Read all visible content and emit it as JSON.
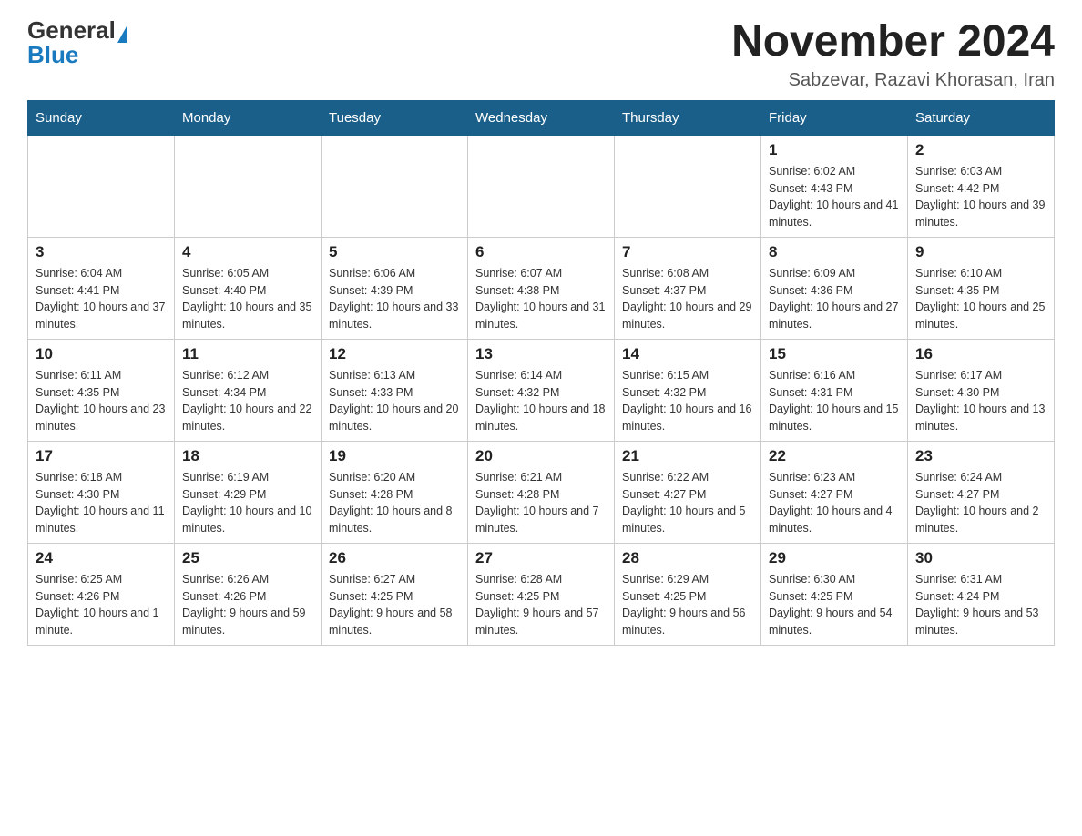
{
  "header": {
    "logo_general": "General",
    "logo_blue": "Blue",
    "month_title": "November 2024",
    "location": "Sabzevar, Razavi Khorasan, Iran"
  },
  "weekdays": [
    "Sunday",
    "Monday",
    "Tuesday",
    "Wednesday",
    "Thursday",
    "Friday",
    "Saturday"
  ],
  "weeks": [
    [
      {
        "day": "",
        "info": ""
      },
      {
        "day": "",
        "info": ""
      },
      {
        "day": "",
        "info": ""
      },
      {
        "day": "",
        "info": ""
      },
      {
        "day": "",
        "info": ""
      },
      {
        "day": "1",
        "info": "Sunrise: 6:02 AM\nSunset: 4:43 PM\nDaylight: 10 hours and 41 minutes."
      },
      {
        "day": "2",
        "info": "Sunrise: 6:03 AM\nSunset: 4:42 PM\nDaylight: 10 hours and 39 minutes."
      }
    ],
    [
      {
        "day": "3",
        "info": "Sunrise: 6:04 AM\nSunset: 4:41 PM\nDaylight: 10 hours and 37 minutes."
      },
      {
        "day": "4",
        "info": "Sunrise: 6:05 AM\nSunset: 4:40 PM\nDaylight: 10 hours and 35 minutes."
      },
      {
        "day": "5",
        "info": "Sunrise: 6:06 AM\nSunset: 4:39 PM\nDaylight: 10 hours and 33 minutes."
      },
      {
        "day": "6",
        "info": "Sunrise: 6:07 AM\nSunset: 4:38 PM\nDaylight: 10 hours and 31 minutes."
      },
      {
        "day": "7",
        "info": "Sunrise: 6:08 AM\nSunset: 4:37 PM\nDaylight: 10 hours and 29 minutes."
      },
      {
        "day": "8",
        "info": "Sunrise: 6:09 AM\nSunset: 4:36 PM\nDaylight: 10 hours and 27 minutes."
      },
      {
        "day": "9",
        "info": "Sunrise: 6:10 AM\nSunset: 4:35 PM\nDaylight: 10 hours and 25 minutes."
      }
    ],
    [
      {
        "day": "10",
        "info": "Sunrise: 6:11 AM\nSunset: 4:35 PM\nDaylight: 10 hours and 23 minutes."
      },
      {
        "day": "11",
        "info": "Sunrise: 6:12 AM\nSunset: 4:34 PM\nDaylight: 10 hours and 22 minutes."
      },
      {
        "day": "12",
        "info": "Sunrise: 6:13 AM\nSunset: 4:33 PM\nDaylight: 10 hours and 20 minutes."
      },
      {
        "day": "13",
        "info": "Sunrise: 6:14 AM\nSunset: 4:32 PM\nDaylight: 10 hours and 18 minutes."
      },
      {
        "day": "14",
        "info": "Sunrise: 6:15 AM\nSunset: 4:32 PM\nDaylight: 10 hours and 16 minutes."
      },
      {
        "day": "15",
        "info": "Sunrise: 6:16 AM\nSunset: 4:31 PM\nDaylight: 10 hours and 15 minutes."
      },
      {
        "day": "16",
        "info": "Sunrise: 6:17 AM\nSunset: 4:30 PM\nDaylight: 10 hours and 13 minutes."
      }
    ],
    [
      {
        "day": "17",
        "info": "Sunrise: 6:18 AM\nSunset: 4:30 PM\nDaylight: 10 hours and 11 minutes."
      },
      {
        "day": "18",
        "info": "Sunrise: 6:19 AM\nSunset: 4:29 PM\nDaylight: 10 hours and 10 minutes."
      },
      {
        "day": "19",
        "info": "Sunrise: 6:20 AM\nSunset: 4:28 PM\nDaylight: 10 hours and 8 minutes."
      },
      {
        "day": "20",
        "info": "Sunrise: 6:21 AM\nSunset: 4:28 PM\nDaylight: 10 hours and 7 minutes."
      },
      {
        "day": "21",
        "info": "Sunrise: 6:22 AM\nSunset: 4:27 PM\nDaylight: 10 hours and 5 minutes."
      },
      {
        "day": "22",
        "info": "Sunrise: 6:23 AM\nSunset: 4:27 PM\nDaylight: 10 hours and 4 minutes."
      },
      {
        "day": "23",
        "info": "Sunrise: 6:24 AM\nSunset: 4:27 PM\nDaylight: 10 hours and 2 minutes."
      }
    ],
    [
      {
        "day": "24",
        "info": "Sunrise: 6:25 AM\nSunset: 4:26 PM\nDaylight: 10 hours and 1 minute."
      },
      {
        "day": "25",
        "info": "Sunrise: 6:26 AM\nSunset: 4:26 PM\nDaylight: 9 hours and 59 minutes."
      },
      {
        "day": "26",
        "info": "Sunrise: 6:27 AM\nSunset: 4:25 PM\nDaylight: 9 hours and 58 minutes."
      },
      {
        "day": "27",
        "info": "Sunrise: 6:28 AM\nSunset: 4:25 PM\nDaylight: 9 hours and 57 minutes."
      },
      {
        "day": "28",
        "info": "Sunrise: 6:29 AM\nSunset: 4:25 PM\nDaylight: 9 hours and 56 minutes."
      },
      {
        "day": "29",
        "info": "Sunrise: 6:30 AM\nSunset: 4:25 PM\nDaylight: 9 hours and 54 minutes."
      },
      {
        "day": "30",
        "info": "Sunrise: 6:31 AM\nSunset: 4:24 PM\nDaylight: 9 hours and 53 minutes."
      }
    ]
  ]
}
